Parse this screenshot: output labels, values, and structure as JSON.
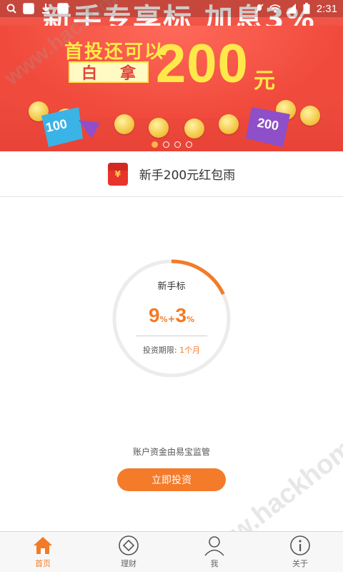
{
  "status_bar": {
    "time": "2:31",
    "icons": [
      "search-icon",
      "app-icon",
      "download-icon",
      "app-icon",
      "mute-icon",
      "wifi-icon",
      "signal-icon",
      "battery-icon"
    ]
  },
  "banner": {
    "top_text": "新手专享标 加息3%",
    "line1": "首投还可以",
    "box_chars": [
      "白",
      "拿"
    ],
    "amount": "200",
    "unit": "元",
    "flag_left": "100",
    "flag_right": "200",
    "page_count": 4,
    "active_page": 1
  },
  "promo": {
    "text": "新手200元红包雨",
    "icon": "red-packet-icon",
    "icon_glyph": "¥"
  },
  "product": {
    "name": "新手标",
    "base_rate": "9",
    "bonus_rate": "3",
    "percent": "%",
    "plus": "+",
    "term_label": "投资期限:",
    "term_value": "1个月",
    "progress": 0.18,
    "accent": "#f37b27"
  },
  "custody_note": "账户资金由易宝监管",
  "invest_button": "立即投资",
  "watermark": "www.hackhome.com",
  "tabs": [
    {
      "label": "首页",
      "icon": "home-icon",
      "active": true
    },
    {
      "label": "理财",
      "icon": "diamond-icon",
      "active": false
    },
    {
      "label": "我",
      "icon": "user-icon",
      "active": false
    },
    {
      "label": "关于",
      "icon": "info-icon",
      "active": false
    }
  ]
}
